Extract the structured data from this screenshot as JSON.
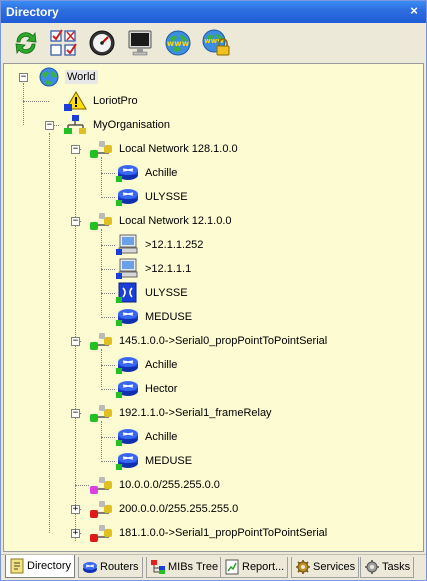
{
  "window": {
    "title": "Directory",
    "close_label": "×"
  },
  "toolbar": {
    "buttons": [
      {
        "icon": "refresh-icon"
      },
      {
        "icon": "checklist-icon"
      },
      {
        "icon": "gauge-icon"
      },
      {
        "icon": "monitor-icon"
      },
      {
        "icon": "globe-www-icon"
      },
      {
        "icon": "globe-lock-icon"
      }
    ]
  },
  "tree": {
    "world": "World",
    "loriotpro": "LoriotPro",
    "myorg": "MyOrganisation",
    "net1": "Local Network 128.1.0.0",
    "net1_achille": "Achille",
    "net1_ulysse": "ULYSSE",
    "net2": "Local Network 12.1.0.0",
    "net2_host1": ">12.1.1.252",
    "net2_host2": ">12.1.1.1",
    "net2_ulysse": "ULYSSE",
    "net2_meduse": "MEDUSE",
    "net3": "145.1.0.0->Serial0_propPointToPointSerial",
    "net3_achille": "Achille",
    "net3_hector": "Hector",
    "net4": "192.1.1.0->Serial1_frameRelay",
    "net4_achille": "Achille",
    "net4_meduse": "MEDUSE",
    "net5": "10.0.0.0/255.255.0.0",
    "net6": "200.0.0.0/255.255.255.0",
    "net7": "181.1.0.0->Serial1_propPointToPointSerial"
  },
  "tabs": [
    {
      "label": "Directory",
      "active": true
    },
    {
      "label": "Routers"
    },
    {
      "label": "MIBs Tree"
    },
    {
      "label": "Report..."
    },
    {
      "label": "Services"
    },
    {
      "label": "Tasks"
    }
  ],
  "colors": {
    "titlebar": "#2e6fe0",
    "tree_background": "#fcfbd2",
    "router_blue": "#1a3fd8",
    "network_green": "#22c022",
    "network_magenta": "#e040e0",
    "network_red": "#e01818"
  }
}
